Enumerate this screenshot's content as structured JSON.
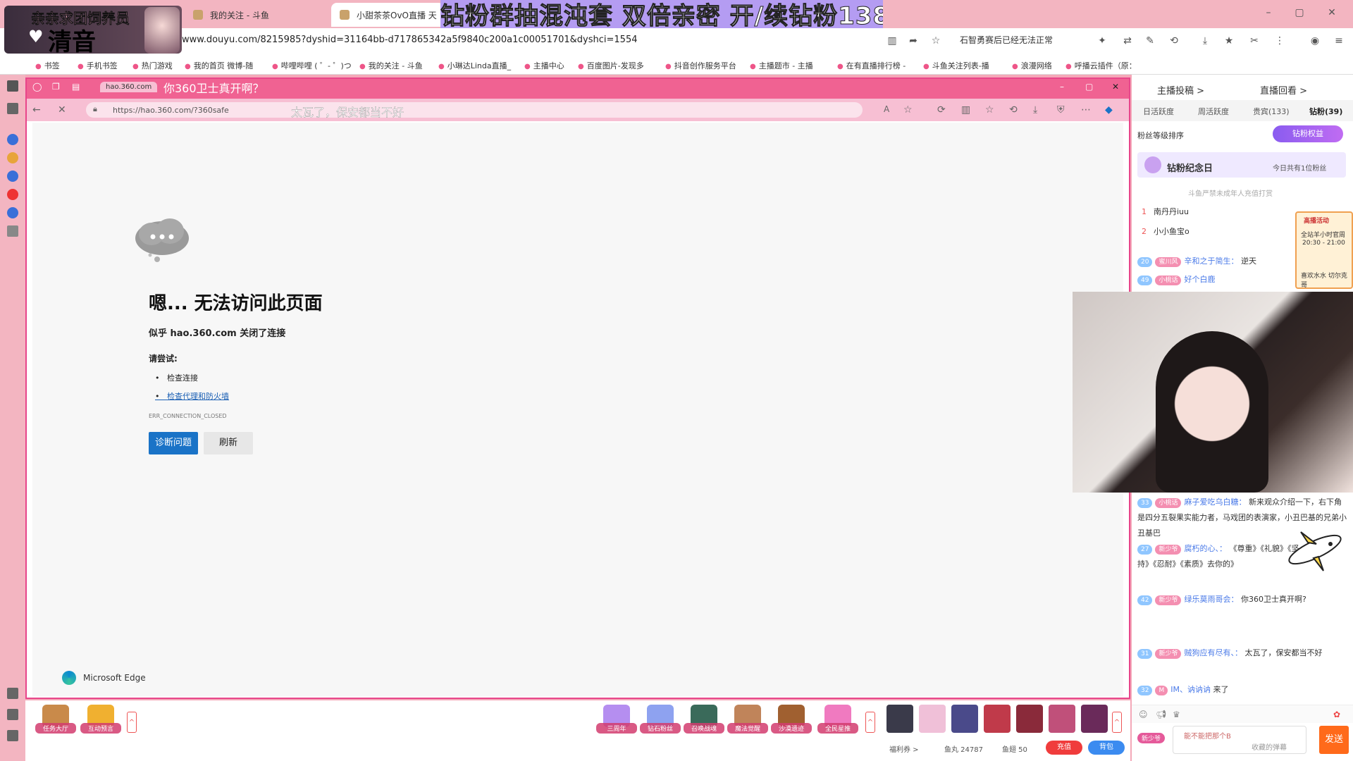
{
  "outer_browser": {
    "tabs": [
      {
        "label": "亲亲"
      },
      {
        "label": "我的关注 - 斗鱼"
      },
      {
        "label": "小甜茶茶OvO直播 天"
      }
    ],
    "url": "www.douyu.com/8215985?dyshid=31164bb-d717865342a5f9840c200a1c00051701&dyshci=1554",
    "notice": "石智勇赛后已经无法正常",
    "bookmarks": [
      "书签",
      "手机书签",
      "热门游戏",
      "我的首页 微博-随",
      "哔哩哔哩 ( ゜- ゜)つ",
      "我的关注 - 斗鱼",
      "小琳达Linda直播_",
      "主播中心",
      "百度图片-发现多",
      "抖音创作服务平台",
      "主播题市 - 主播",
      "在有直播排行榜 -",
      "斗鱼关注列表-播",
      "浪漫网络",
      "呼播云插件（原："
    ]
  },
  "banner": {
    "text": "钻粉群抽混沌套  双倍亲密 开/续钻粉138"
  },
  "stream_badge": {
    "line1": "亲亲求团饲养员",
    "heart": "♥",
    "line2": "清音"
  },
  "inner_browser": {
    "tab_label": "hao.360.com",
    "url": "https://hao.360.com/?360safe",
    "danmu_title": "你360卫士真开啊？",
    "danmu_addr": "太瓦了，保安都当不好"
  },
  "error_page": {
    "title": "嗯... 无法访问此页面",
    "subtitle": "似乎 hao.360.com 关闭了连接",
    "try_label": "请尝试:",
    "bullets": [
      "检查连接",
      "检查代理和防火墙"
    ],
    "code": "ERR_CONNECTION_CLOSED",
    "diagnose_button": "诊断问题",
    "refresh_button": "刷新",
    "brand": "Microsoft Edge"
  },
  "right_panel": {
    "tabs": [
      "主播投稿 >",
      "直播回看 >"
    ],
    "subtabs": [
      "日活跃度",
      "周活跃度",
      "贵宾(133)",
      "钻粉(39)"
    ],
    "rank_label": "粉丝等级排序",
    "diamond_button": "钻粉权益",
    "memorial_title": "钻粉纪念日",
    "memorial_right": "今日共有1位粉丝",
    "notice": "斗鱼严禁未成年人充值打赏",
    "fans": [
      {
        "rank": "1",
        "name": "南丹丹iuu"
      },
      {
        "rank": "2",
        "name": "小小鱼宝o"
      }
    ],
    "event": {
      "title": "高播活动",
      "name": "全站羊小时官周",
      "time": "20:30 - 21:00",
      "tag": "喜欢水水 切尔克哥"
    },
    "chat": [
      {
        "level": "20",
        "badge": "蜜川风",
        "name": "辛和之于简生：",
        "text": "逆天"
      },
      {
        "level": "49",
        "badge": "小桃话",
        "name": "好个白鹿",
        "text": ""
      },
      {
        "level": "33",
        "badge": "小桃话",
        "name": "麻子爱吃乌白糖：",
        "text": "新来观众介绍一下，右下角是四分五裂果实能力者，马戏团的表演家，小丑巴基的兄弟小丑基巴"
      },
      {
        "level": "27",
        "badge": "新少爷",
        "name": "腐朽的心、：",
        "text": "《尊重》《礼貌》《坚持》《忍耐》《素质》去你的》"
      },
      {
        "level": "42",
        "badge": "新少爷",
        "name": "绿乐莫雨哥会：",
        "text": "你360卫士真开啊?"
      },
      {
        "level": "31",
        "badge": "新少爷",
        "name": "贼狗应有尽有、：",
        "text": "太瓦了，保安都当不好"
      },
      {
        "level": "32",
        "badge": "M",
        "name": "IM、讷讷讷",
        "text": "来了"
      }
    ],
    "chat_placeholder": "能不能把那个B",
    "chat_link": "收藏的弹幕",
    "send_button": "发送",
    "input_badge": "新少爷"
  },
  "bottom_bar": {
    "left_items": [
      "任务大厅",
      "互动预言"
    ],
    "gifts": [
      "三周年",
      "钻石粉丝",
      "召唤战魂",
      "魔法觉醒",
      "沙漠遗迹",
      "全民星推"
    ],
    "welfare": "福利券 >",
    "fish_balls": "鱼丸 24787",
    "fish_fins": "鱼翅 50",
    "recharge": "充值",
    "bag": "背包"
  },
  "colors": {
    "accent": "#f06292",
    "edge_blue": "#1a73c7",
    "send_orange": "#ff6a1a"
  }
}
